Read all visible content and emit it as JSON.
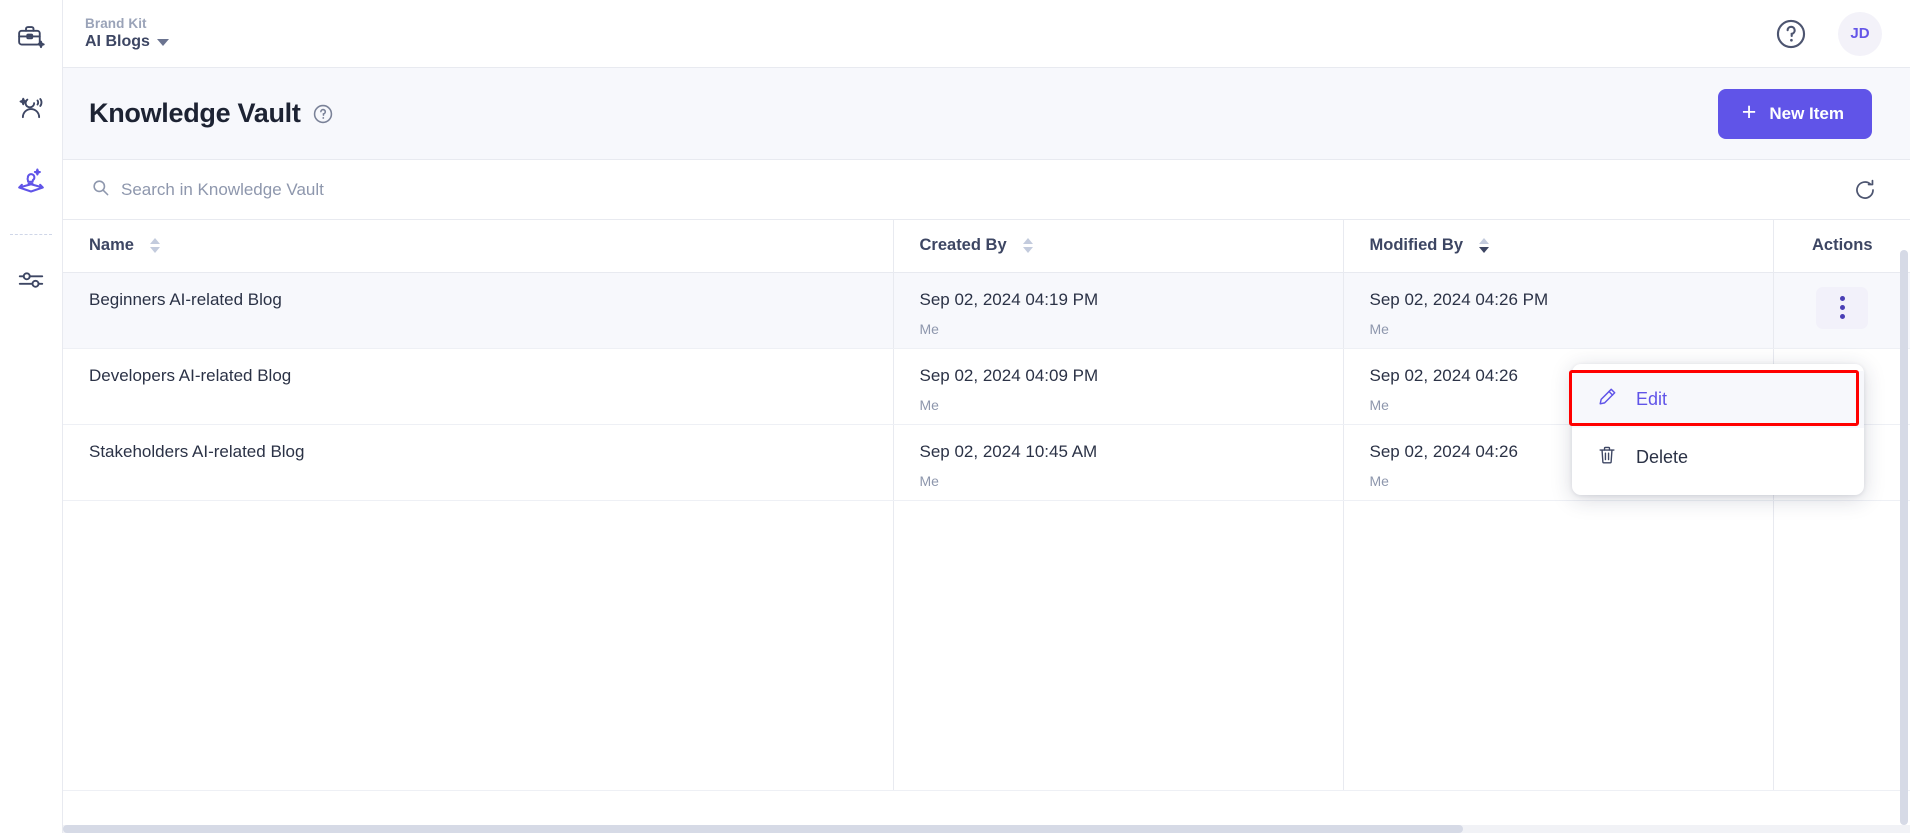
{
  "sidebar": {
    "items": [
      {
        "name": "brand-kit",
        "icon": "briefcase-sparkle-icon",
        "active": false
      },
      {
        "name": "persona",
        "icon": "person-sparkle-sound-icon",
        "active": false
      },
      {
        "name": "knowledge-vault",
        "icon": "book-idea-sparkle-icon",
        "active": true
      },
      {
        "name": "settings",
        "icon": "sliders-icon",
        "active": false
      }
    ]
  },
  "topbar": {
    "brand_label": "Brand Kit",
    "workspace": "AI Blogs",
    "help_icon": "question-circle-icon",
    "avatar_initials": "JD"
  },
  "page": {
    "title": "Knowledge Vault",
    "title_help_icon": "question-circle-icon",
    "new_item_label": "New Item",
    "new_item_icon": "plus-icon",
    "accent_color": "#6054e8"
  },
  "search": {
    "placeholder": "Search in Knowledge Vault",
    "value": "",
    "icon": "search-icon",
    "refresh_icon": "refresh-icon"
  },
  "table": {
    "columns": [
      {
        "label": "Name",
        "sortable": true,
        "sort": "none"
      },
      {
        "label": "Created By",
        "sortable": true,
        "sort": "none"
      },
      {
        "label": "Modified By",
        "sortable": true,
        "sort": "desc"
      },
      {
        "label": "Actions",
        "sortable": false,
        "sort": "none"
      }
    ],
    "rows": [
      {
        "name": "Beginners AI-related Blog",
        "created_date": "Sep 02, 2024 04:19 PM",
        "created_by": "Me",
        "modified_date": "Sep 02, 2024 04:26 PM",
        "modified_by": "Me",
        "actions_icon": "kebab-menu-icon"
      },
      {
        "name": "Developers AI-related Blog",
        "created_date": "Sep 02, 2024 04:09 PM",
        "created_by": "Me",
        "modified_date": "Sep 02, 2024 04:26",
        "modified_by": "Me",
        "actions_icon": "kebab-menu-icon"
      },
      {
        "name": "Stakeholders AI-related Blog",
        "created_date": "Sep 02, 2024 10:45 AM",
        "created_by": "Me",
        "modified_date": "Sep 02, 2024 04:26",
        "modified_by": "Me",
        "actions_icon": "kebab-menu-icon"
      }
    ]
  },
  "context_menu": {
    "open": true,
    "items": [
      {
        "label": "Edit",
        "icon": "pencil-icon",
        "highlighted": true
      },
      {
        "label": "Delete",
        "icon": "trash-icon",
        "highlighted": false
      }
    ],
    "highlight_color": "#ff0000"
  }
}
